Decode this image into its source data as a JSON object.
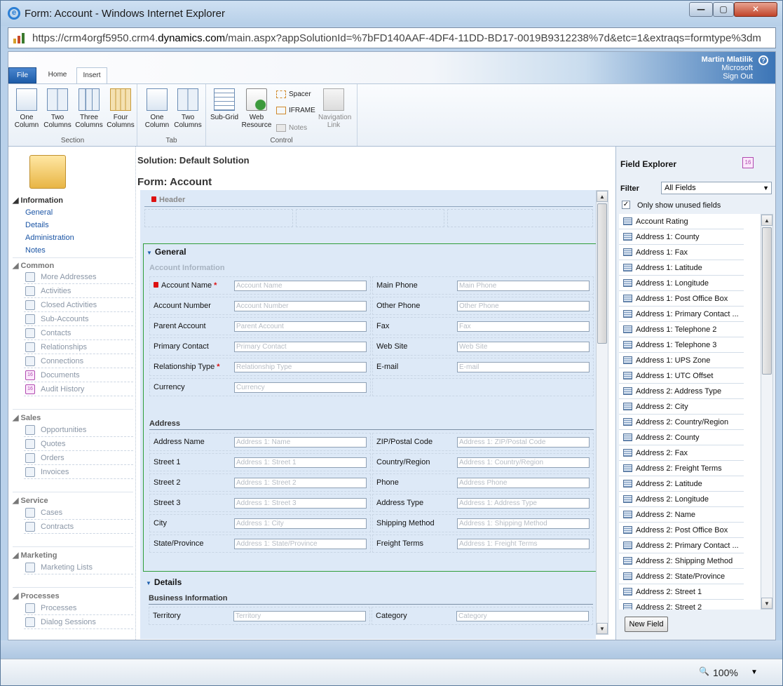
{
  "window": {
    "title": "Form: Account - Windows Internet Explorer",
    "url_prefix": "https://crm4orgf5950.crm4.",
    "url_domain": "dynamics.com",
    "url_suffix": "/main.aspx?appSolutionId=%7bFD140AAF-4DF4-11DD-BD17-0019B9312238%7d&etc=1&extraqs=formtype%3dm",
    "btn_min": "—",
    "btn_max": "▢",
    "btn_close": "✕"
  },
  "user": {
    "name": "Martin Mlatilik",
    "org": "Microsoft",
    "signout": "Sign Out",
    "help": "?"
  },
  "ribbon": {
    "tabs": {
      "file": "File",
      "home": "Home",
      "insert": "Insert"
    },
    "section_group": {
      "label": "Section",
      "buttons": [
        {
          "line1": "One",
          "line2": "Column"
        },
        {
          "line1": "Two",
          "line2": "Columns"
        },
        {
          "line1": "Three",
          "line2": "Columns"
        },
        {
          "line1": "Four",
          "line2": "Columns"
        }
      ]
    },
    "tab_group": {
      "label": "Tab",
      "buttons": [
        {
          "line1": "One",
          "line2": "Column"
        },
        {
          "line1": "Two",
          "line2": "Columns"
        }
      ]
    },
    "control_group": {
      "label": "Control",
      "subgrid": {
        "line1": "Sub-Grid",
        "line2": ""
      },
      "web_resource": {
        "line1": "Web",
        "line2": "Resource"
      },
      "spacer": "Spacer",
      "iframe": "IFRAME",
      "notes": "Notes",
      "nav_link": {
        "line1": "Navigation",
        "line2": "Link"
      }
    }
  },
  "nav": {
    "information": {
      "heading": "Information",
      "links": [
        "General",
        "Details",
        "Administration",
        "Notes"
      ]
    },
    "common": {
      "heading": "Common",
      "items": [
        "More Addresses",
        "Activities",
        "Closed Activities",
        "Sub-Accounts",
        "Contacts",
        "Relationships",
        "Connections",
        "Documents",
        "Audit History"
      ]
    },
    "sales": {
      "heading": "Sales",
      "items": [
        "Opportunities",
        "Quotes",
        "Orders",
        "Invoices"
      ]
    },
    "service": {
      "heading": "Service",
      "items": [
        "Cases",
        "Contracts"
      ]
    },
    "marketing": {
      "heading": "Marketing",
      "items": [
        "Marketing Lists"
      ]
    },
    "processes": {
      "heading": "Processes",
      "items": [
        "Processes",
        "Dialog Sessions"
      ]
    }
  },
  "main": {
    "solution": "Solution: Default Solution",
    "form_prefix": "Form: ",
    "form_name": "Account",
    "header_label": "Header",
    "general": {
      "title": "General",
      "account_info": "Account Information",
      "rows": [
        {
          "l_label": "Account Name",
          "l_ph": "Account Name",
          "r_label": "Main Phone",
          "r_ph": "Main Phone"
        },
        {
          "l_label": "Account Number",
          "l_ph": "Account Number",
          "r_label": "Other Phone",
          "r_ph": "Other Phone"
        },
        {
          "l_label": "Parent Account",
          "l_ph": "Parent Account",
          "r_label": "Fax",
          "r_ph": "Fax"
        },
        {
          "l_label": "Primary Contact",
          "l_ph": "Primary Contact",
          "r_label": "Web Site",
          "r_ph": "Web Site"
        },
        {
          "l_label": "Relationship Type",
          "l_ph": "Relationship Type",
          "r_label": "E-mail",
          "r_ph": "E-mail"
        },
        {
          "l_label": "Currency",
          "l_ph": "Currency",
          "r_label": "",
          "r_ph": ""
        }
      ],
      "required_marker": "*",
      "address_title": "Address",
      "address_rows": [
        {
          "l_label": "Address Name",
          "l_ph": "Address 1: Name",
          "r_label": "ZIP/Postal Code",
          "r_ph": "Address 1: ZIP/Postal Code"
        },
        {
          "l_label": "Street 1",
          "l_ph": "Address 1: Street 1",
          "r_label": "Country/Region",
          "r_ph": "Address 1: Country/Region"
        },
        {
          "l_label": "Street 2",
          "l_ph": "Address 1: Street 2",
          "r_label": "Phone",
          "r_ph": "Address Phone"
        },
        {
          "l_label": "Street 3",
          "l_ph": "Address 1: Street 3",
          "r_label": "Address Type",
          "r_ph": "Address 1: Address Type"
        },
        {
          "l_label": "City",
          "l_ph": "Address 1: City",
          "r_label": "Shipping Method",
          "r_ph": "Address 1: Shipping Method"
        },
        {
          "l_label": "State/Province",
          "l_ph": "Address 1: State/Province",
          "r_label": "Freight Terms",
          "r_ph": "Address 1: Freight Terms"
        }
      ]
    },
    "details": {
      "title": "Details",
      "business_info": "Business Information",
      "row": {
        "l_label": "Territory",
        "l_ph": "Territory",
        "r_label": "Category",
        "r_ph": "Category"
      }
    }
  },
  "field_explorer": {
    "title": "Field Explorer",
    "badge": "16",
    "filter_label": "Filter",
    "filter_value": "All Fields",
    "only_unused": "Only show unused fields",
    "check_mark": "✓",
    "fields": [
      "Account Rating",
      "Address 1: County",
      "Address 1: Fax",
      "Address 1: Latitude",
      "Address 1: Longitude",
      "Address 1: Post Office Box",
      "Address 1: Primary Contact ...",
      "Address 1: Telephone 2",
      "Address 1: Telephone 3",
      "Address 1: UPS Zone",
      "Address 1: UTC Offset",
      "Address 2: Address Type",
      "Address 2: City",
      "Address 2: Country/Region",
      "Address 2: County",
      "Address 2: Fax",
      "Address 2: Freight Terms",
      "Address 2: Latitude",
      "Address 2: Longitude",
      "Address 2: Name",
      "Address 2: Post Office Box",
      "Address 2: Primary Contact ...",
      "Address 2: Shipping Method",
      "Address 2: State/Province",
      "Address 2: Street 1",
      "Address 2: Street 2"
    ],
    "new_field": "New Field"
  },
  "status": {
    "zoom": "100%"
  },
  "badge_16": "16"
}
